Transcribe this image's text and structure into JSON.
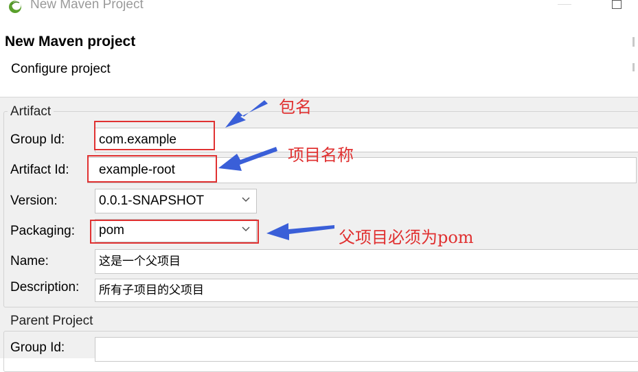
{
  "window": {
    "title": "New Maven Project",
    "app_icon": "eclipse-icon",
    "maximize_icon": "maximize-icon"
  },
  "wizard": {
    "title": "New Maven project",
    "subtitle": "Configure project"
  },
  "artifact": {
    "legend": "Artifact",
    "group_id_label": "Group Id:",
    "group_id_value": "com.example",
    "artifact_id_label": "Artifact Id:",
    "artifact_id_value": "example-root",
    "version_label": "Version:",
    "version_value": "0.0.1-SNAPSHOT",
    "packaging_label": "Packaging:",
    "packaging_value": "pom",
    "name_label": "Name:",
    "name_value": "这是一个父项目",
    "description_label": "Description:",
    "description_value": "所有子项目的父项目"
  },
  "parent": {
    "legend": "Parent Project",
    "group_id_label": "Group Id:",
    "group_id_value": ""
  },
  "annotations": {
    "group_id_note": "包名",
    "artifact_id_note": "项目名称",
    "packaging_note": "父项目必须为pom",
    "color": "#e03030",
    "arrow_color": "#3a5fd8"
  }
}
